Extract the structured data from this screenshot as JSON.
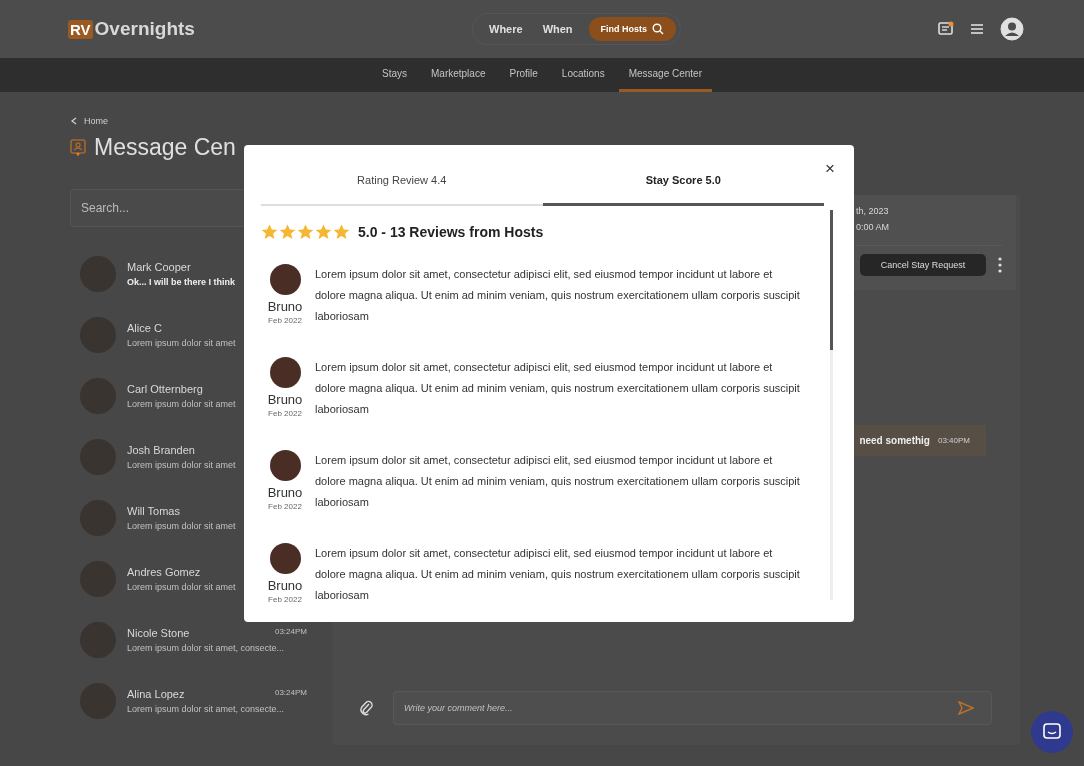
{
  "header": {
    "logo_badge": "RV",
    "logo_text": "Overnights",
    "search": {
      "where": "Where",
      "when": "When",
      "button": "Find Hosts"
    }
  },
  "nav": [
    {
      "label": "Stays",
      "selected": false
    },
    {
      "label": "Marketplace",
      "selected": false
    },
    {
      "label": "Profile",
      "selected": false
    },
    {
      "label": "Locations",
      "selected": false
    },
    {
      "label": "Message Center",
      "selected": true
    }
  ],
  "breadcrumb": "Home",
  "page_title": "Message Cen",
  "search": {
    "placeholder": "Search..."
  },
  "conversations": [
    {
      "name": "Mark Cooper",
      "preview": "Ok... I will be there I think",
      "unread": true
    },
    {
      "name": "Alice C",
      "preview": "Lorem ipsum dolor sit amet",
      "unread": false
    },
    {
      "name": "Carl Otternberg",
      "preview": "Lorem ipsum dolor sit amet",
      "unread": false
    },
    {
      "name": "Josh Branden",
      "preview": "Lorem ipsum dolor sit amet",
      "unread": false
    },
    {
      "name": "Will Tomas",
      "preview": "Lorem ipsum dolor sit amet",
      "unread": false
    },
    {
      "name": "Andres Gomez",
      "preview": "Lorem ipsum dolor sit amet",
      "unread": false
    },
    {
      "name": "Nicole Stone",
      "preview": "Lorem ipsum dolor sit amet, consecte...",
      "time": "03:24PM",
      "unread": false
    },
    {
      "name": "Alina Lopez",
      "preview": "Lorem ipsum dolor sit amet, consecte...",
      "time": "03:24PM",
      "unread": false
    }
  ],
  "stay_card": {
    "date": "th, 2023",
    "time": "0:00 AM",
    "button": "Cancel Stay Request"
  },
  "message": {
    "text": "need somethig",
    "time": "03:40PM"
  },
  "composer": {
    "placeholder": "Write your comment here..."
  },
  "modal": {
    "close": "×",
    "tabs": [
      {
        "label": "Rating Review 4.4",
        "selected": false
      },
      {
        "label": "Stay Score 5.0",
        "selected": true
      }
    ],
    "stars": 5,
    "summary": "5.0 - 13 Reviews from Hosts",
    "reviews": [
      {
        "name": "Bruno",
        "date": "Feb 2022",
        "text": "Lorem ipsum dolor sit amet, consectetur adipisci elit, sed eiusmod tempor incidunt ut labore et dolore magna aliqua. Ut enim ad minim veniam, quis nostrum exercitationem ullam corporis suscipit laboriosam"
      },
      {
        "name": "Bruno",
        "date": "Feb 2022",
        "text": "Lorem ipsum dolor sit amet, consectetur adipisci elit, sed eiusmod tempor incidunt ut labore et dolore magna aliqua. Ut enim ad minim veniam, quis nostrum exercitationem ullam corporis suscipit laboriosam"
      },
      {
        "name": "Bruno",
        "date": "Feb 2022",
        "text": "Lorem ipsum dolor sit amet, consectetur adipisci elit, sed eiusmod tempor incidunt ut labore et dolore magna aliqua. Ut enim ad minim veniam, quis nostrum exercitationem ullam corporis suscipit laboriosam"
      },
      {
        "name": "Bruno",
        "date": "Feb 2022",
        "text": "Lorem ipsum dolor sit amet, consectetur adipisci elit, sed eiusmod tempor incidunt ut labore et dolore magna aliqua. Ut enim ad minim veniam, quis nostrum exercitationem ullam corporis suscipit laboriosam"
      }
    ]
  }
}
